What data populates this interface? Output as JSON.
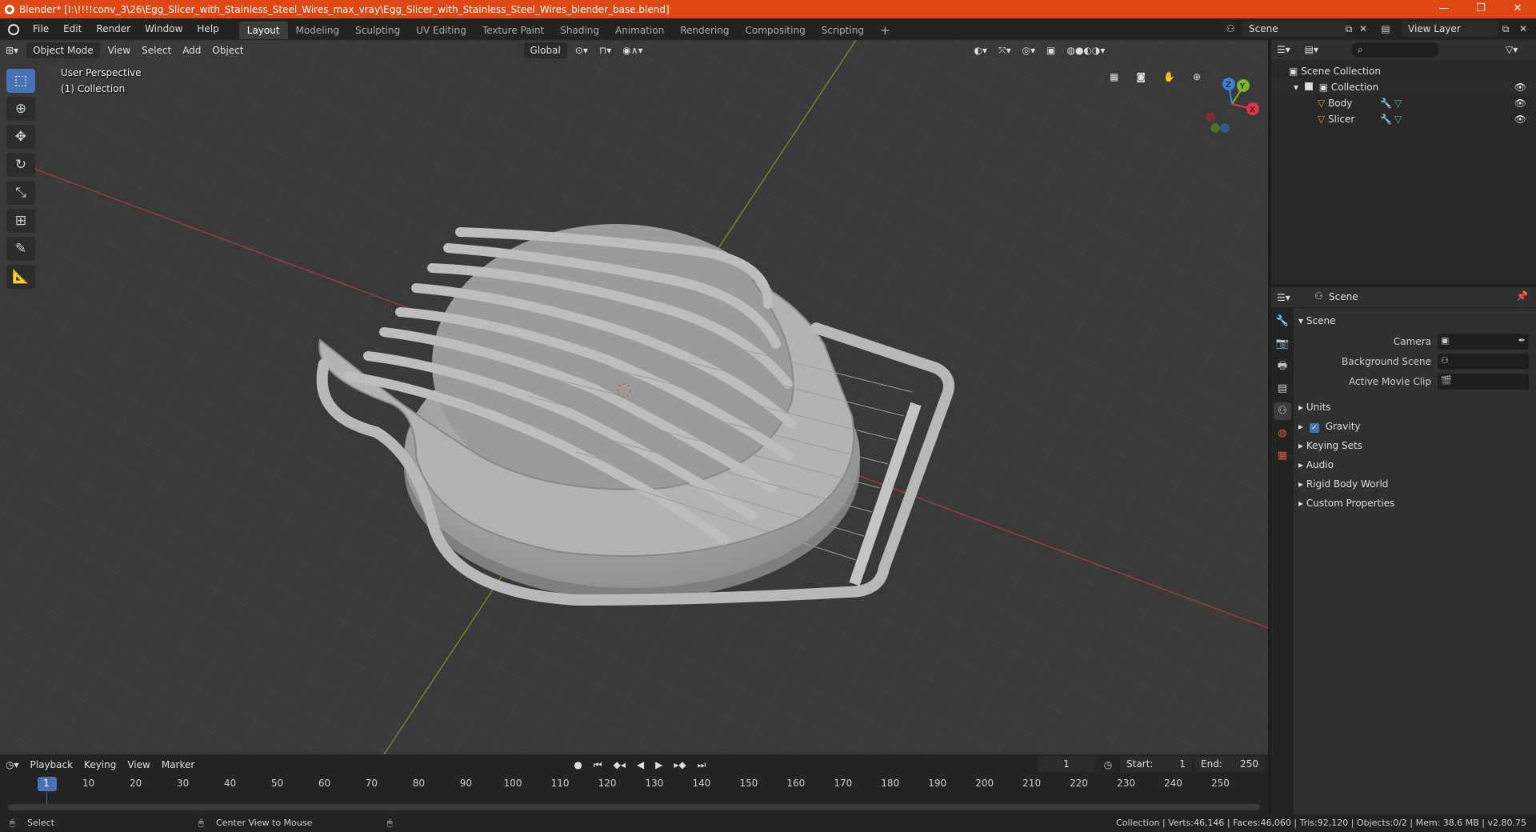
{
  "window": {
    "title": "Blender* [I:\\!!!!conv_3\\26\\Egg_Slicer_with_Stainless_Steel_Wires_max_vray\\Egg_Slicer_with_Stainless_Steel_Wires_blender_base.blend]",
    "controls": [
      "—",
      "❐",
      "✕"
    ]
  },
  "menu": [
    "File",
    "Edit",
    "Render",
    "Window",
    "Help"
  ],
  "workspaces": [
    "Layout",
    "Modeling",
    "Sculpting",
    "UV Editing",
    "Texture Paint",
    "Shading",
    "Animation",
    "Rendering",
    "Compositing",
    "Scripting"
  ],
  "active_workspace": "Layout",
  "scene_field": "Scene",
  "view_layer_field": "View Layer",
  "viewport": {
    "mode": "Object Mode",
    "menus": [
      "View",
      "Select",
      "Add",
      "Object"
    ],
    "orientation": "Global",
    "view_name": "User Perspective",
    "collection_name": "(1) Collection",
    "gizmo_axes": {
      "x": "X",
      "y": "Y",
      "z": "Z"
    },
    "colors": {
      "bg": "#393939",
      "x_axis": "#c84b4b",
      "y_axis": "#7ab430",
      "x_dot": "#e2334a",
      "y_dot": "#7ab430",
      "z_dot": "#3d7fd9"
    }
  },
  "outliner": {
    "root": "Scene Collection",
    "collection": "Collection",
    "objects": [
      "Body",
      "Slicer"
    ]
  },
  "properties": {
    "header": "Scene",
    "section": "Scene",
    "fields": [
      {
        "label": "Camera"
      },
      {
        "label": "Background Scene"
      },
      {
        "label": "Active Movie Clip"
      }
    ],
    "panels": [
      "Units",
      "Gravity",
      "Keying Sets",
      "Audio",
      "Rigid Body World",
      "Custom Properties"
    ]
  },
  "timeline": {
    "menus": [
      "Playback",
      "Keying",
      "View",
      "Marker"
    ],
    "current_frame": "1",
    "start_label": "Start:",
    "start": "1",
    "end_label": "End:",
    "end": "250",
    "ruler": [
      "1",
      "10",
      "20",
      "30",
      "40",
      "50",
      "60",
      "70",
      "80",
      "90",
      "100",
      "110",
      "120",
      "130",
      "140",
      "150",
      "160",
      "170",
      "180",
      "190",
      "200",
      "210",
      "220",
      "230",
      "240",
      "250"
    ]
  },
  "status": {
    "left": "Select",
    "middle": "Center View to Mouse",
    "right": "Collection | Verts:46,146 | Faces:46,060 | Tris:92,120 | Objects:0/2 | Mem: 38.6 MB | v2.80.75"
  }
}
